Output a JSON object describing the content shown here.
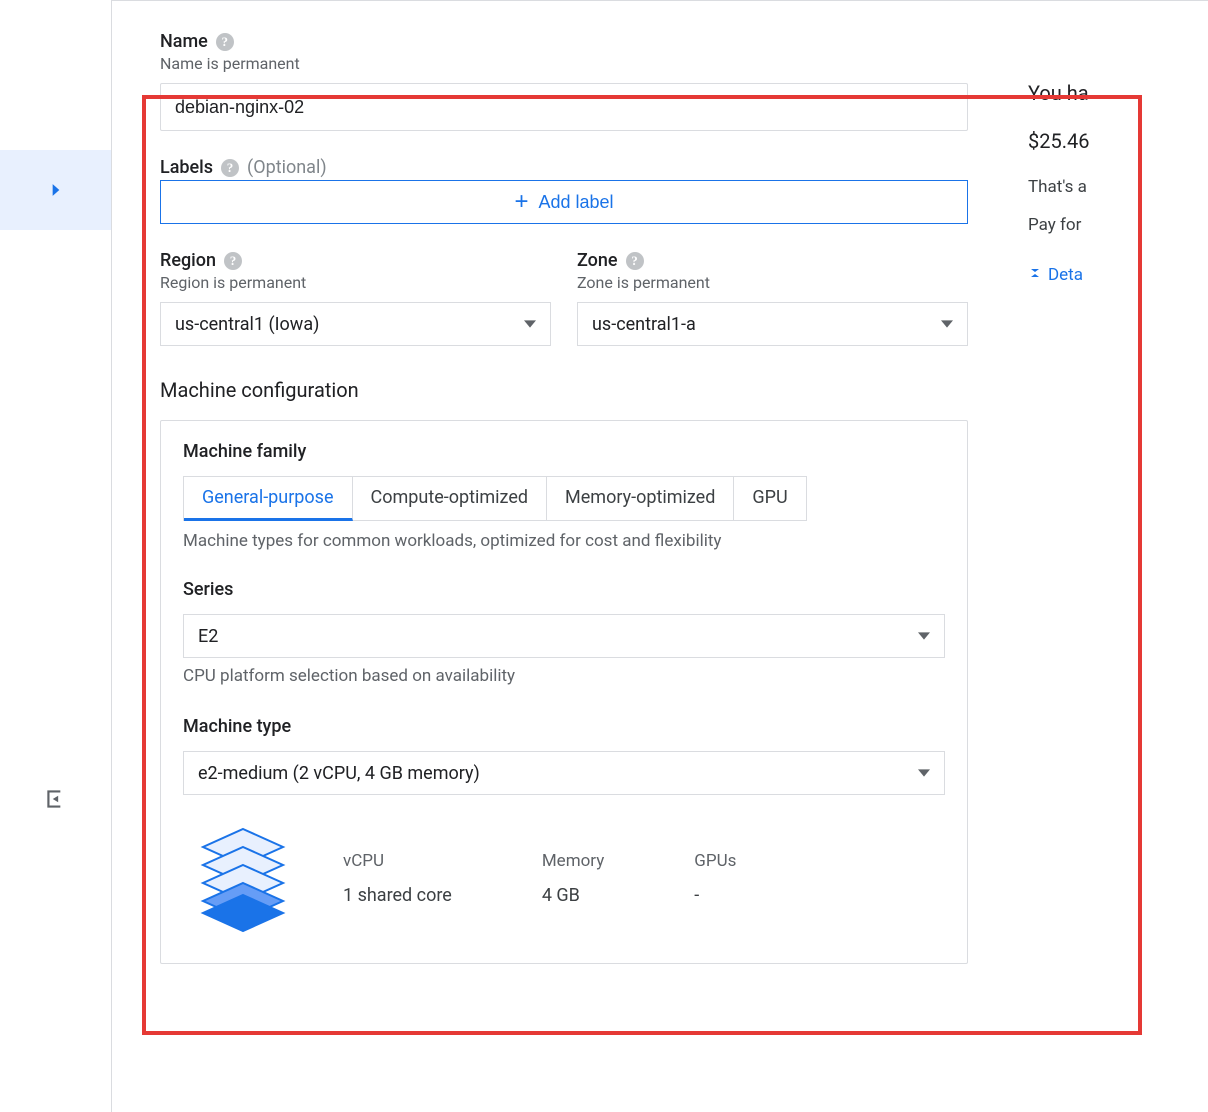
{
  "form": {
    "name": {
      "label": "Name",
      "sub": "Name is permanent",
      "value": "debian-nginx-02"
    },
    "labels": {
      "label": "Labels",
      "optional": "(Optional)",
      "add_button": "Add label"
    },
    "region": {
      "label": "Region",
      "sub": "Region is permanent",
      "value": "us-central1 (Iowa)"
    },
    "zone": {
      "label": "Zone",
      "sub": "Zone is permanent",
      "value": "us-central1-a"
    },
    "machine_config_title": "Machine configuration",
    "machine_family_label": "Machine family",
    "tabs": [
      "General-purpose",
      "Compute-optimized",
      "Memory-optimized",
      "GPU"
    ],
    "tab_desc": "Machine types for common workloads, optimized for cost and flexibility",
    "series": {
      "label": "Series",
      "value": "E2",
      "desc": "CPU platform selection based on availability"
    },
    "machine_type": {
      "label": "Machine type",
      "value": "e2-medium (2 vCPU, 4 GB memory)"
    },
    "specs": {
      "vcpu_label": "vCPU",
      "vcpu_value": "1 shared core",
      "memory_label": "Memory",
      "memory_value": "4 GB",
      "gpus_label": "GPUs",
      "gpus_value": "-"
    }
  },
  "side": {
    "line1": "You ha",
    "line2": "$25.46",
    "line3": "That's a",
    "line4": "Pay for",
    "details": "Deta"
  }
}
